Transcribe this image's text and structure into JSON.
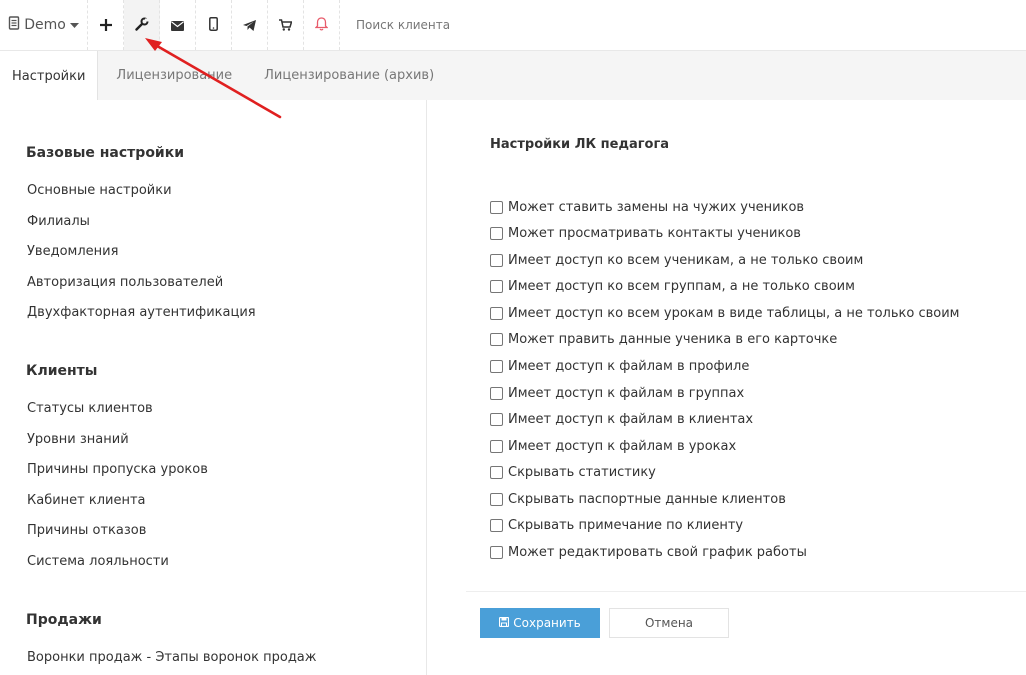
{
  "toolbar": {
    "demo_label": "Demo",
    "search_placeholder": "Поиск клиента",
    "icons": [
      "document-icon",
      "plus-icon",
      "wrench-icon",
      "envelope-icon",
      "phone-icon",
      "telegram-icon",
      "cart-icon",
      "bell-icon"
    ],
    "colors": {
      "bell": "#e85a6a"
    }
  },
  "tabs": [
    {
      "label": "Настройки",
      "active": true
    },
    {
      "label": "Лицензирование",
      "active": false
    },
    {
      "label": "Лицензирование (архив)",
      "active": false
    }
  ],
  "sidebar": {
    "sections": [
      {
        "title": "Базовые настройки",
        "items": [
          "Основные настройки",
          "Филиалы",
          "Уведомления",
          "Авторизация пользователей",
          "Двухфакторная аутентификация"
        ]
      },
      {
        "title": "Клиенты",
        "items": [
          "Статусы клиентов",
          "Уровни знаний",
          "Причины пропуска уроков",
          "Кабинет клиента",
          "Причины отказов",
          "Система лояльности"
        ]
      },
      {
        "title": "Продажи",
        "items": [
          "Воронки продаж - Этапы воронок продаж"
        ]
      }
    ]
  },
  "panel": {
    "title": "Настройки ЛК педагога",
    "checkboxes": [
      {
        "label": "Может ставить замены на чужих учеников",
        "checked": false
      },
      {
        "label": "Может просматривать контакты учеников",
        "checked": false
      },
      {
        "label": "Имеет доступ ко всем ученикам, а не только своим",
        "checked": false
      },
      {
        "label": "Имеет доступ ко всем группам, а не только своим",
        "checked": false
      },
      {
        "label": "Имеет доступ ко всем урокам в виде таблицы, а не только своим",
        "checked": false
      },
      {
        "label": "Может править данные ученика в его карточке",
        "checked": false
      },
      {
        "label": "Имеет доступ к файлам в профиле",
        "checked": false
      },
      {
        "label": "Имеет доступ к файлам в группах",
        "checked": false
      },
      {
        "label": "Имеет доступ к файлам в клиентах",
        "checked": false
      },
      {
        "label": "Имеет доступ к файлам в уроках",
        "checked": false
      },
      {
        "label": "Скрывать статистику",
        "checked": false
      },
      {
        "label": "Скрывать паспортные данные клиентов",
        "checked": false
      },
      {
        "label": "Скрывать примечание по клиенту",
        "checked": false
      },
      {
        "label": "Может редактировать свой график работы",
        "checked": false
      }
    ],
    "save_label": "Сохранить",
    "cancel_label": "Отмена",
    "colors": {
      "save_button": "#4a9fd8"
    }
  },
  "annotation": {
    "arrow_color": "#e02020"
  }
}
